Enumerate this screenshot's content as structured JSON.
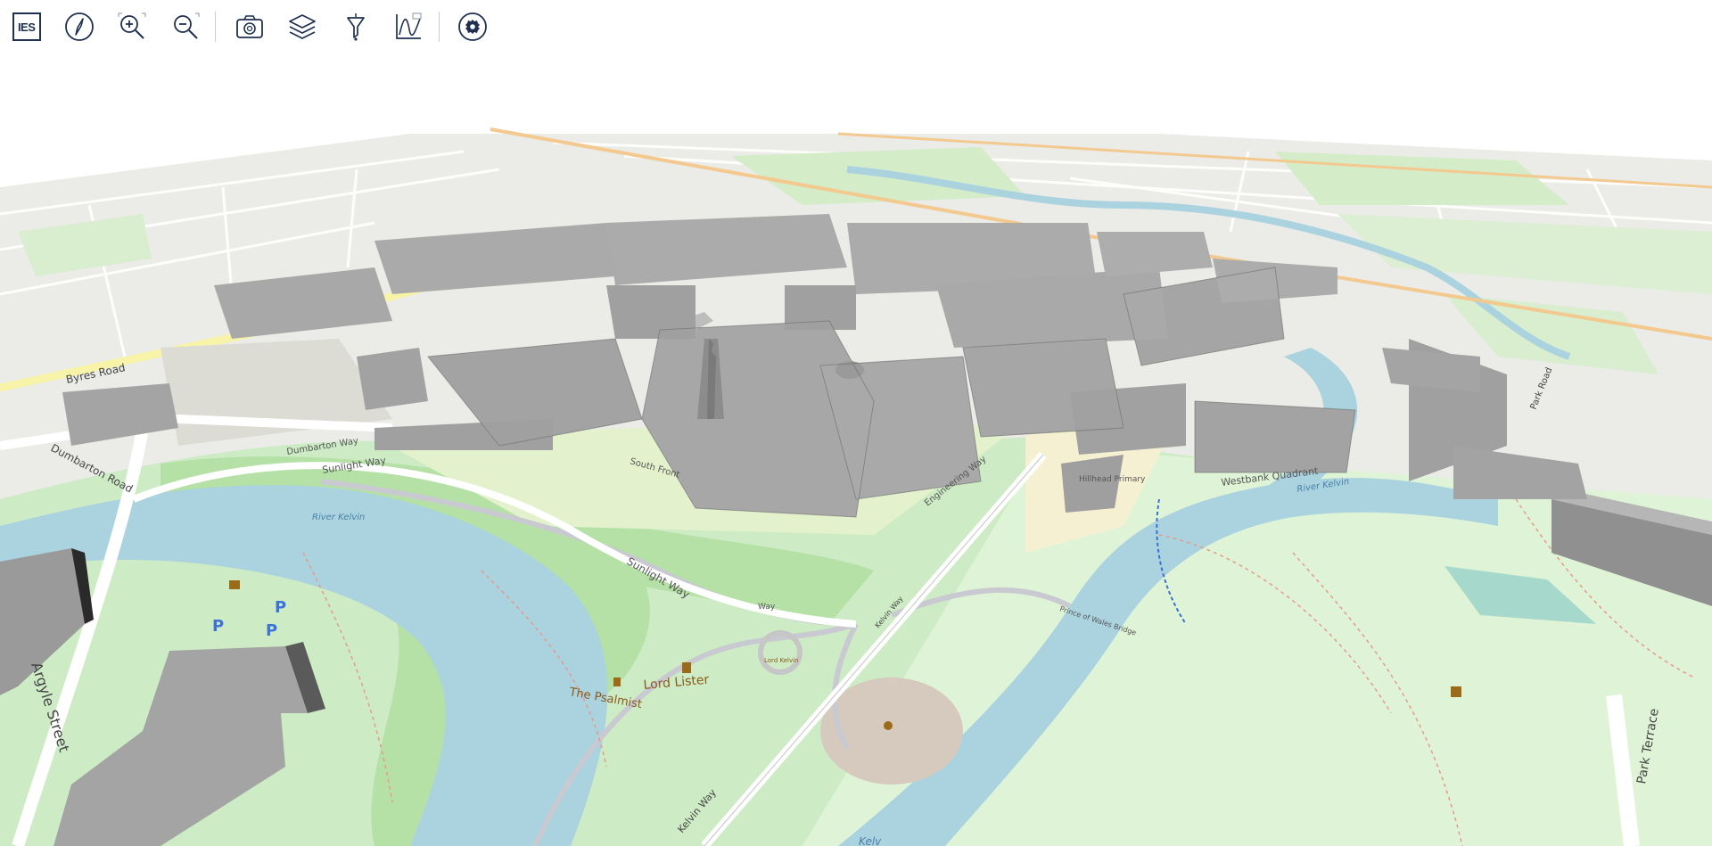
{
  "toolbar": {
    "logo_text": "IES",
    "buttons": [
      {
        "id": "compass",
        "icon": "compass-icon"
      },
      {
        "id": "zoom-in",
        "icon": "zoom-in-icon"
      },
      {
        "id": "zoom-out",
        "icon": "zoom-out-icon"
      },
      {
        "id": "screenshot",
        "icon": "camera-icon"
      },
      {
        "id": "layers",
        "icon": "layers-icon"
      },
      {
        "id": "filter",
        "icon": "filter-icon"
      },
      {
        "id": "chart",
        "icon": "chart-icon"
      },
      {
        "id": "settings",
        "icon": "gear-icon"
      }
    ]
  },
  "map": {
    "colors": {
      "park": "#cdebc4",
      "park_light": "#dff4d6",
      "river": "#aad3df",
      "road": "#ffffff",
      "major_road": "#f6d9a8",
      "building": "#9c9c9c",
      "building_top": "#bdbdbd",
      "urban": "#eaeaea",
      "pitch": "#d6c9bd"
    },
    "labels": {
      "sunlight_way_1": "Sunlight Way",
      "sunlight_way_2": "Sunlight Way",
      "way": "Way",
      "river_kelvin_1": "River Kelvin",
      "river_kelvin_2": "River Kelvin",
      "river_kelvin_bottom": "Kelv",
      "lord_lister": "Lord Lister",
      "the_psalmist": "The Psalmist",
      "lord_kelvin": "Lord Kelvin",
      "kelvin_way_1": "Kelvin Way",
      "kelvin_way_2": "Kelvin Way",
      "south_front": "South Front",
      "engineering_way": "Engineering Way",
      "dumbarton_way": "Dumbarton Way",
      "dumbarton_road": "Dumbarton Road",
      "argyle_street": "Argyle Street",
      "park_terrace": "Park Terrace",
      "princess_bridge": "Prince of Wales Bridge",
      "westbank_quadrant": "Westbank Quadrant",
      "byres_road": "Byres Road",
      "hillhead_primary": "Hillhead Primary",
      "park_road": "Park Road"
    }
  }
}
